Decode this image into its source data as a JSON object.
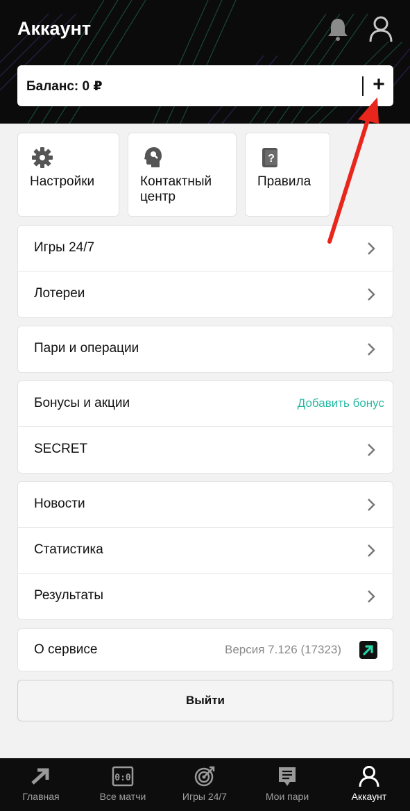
{
  "header": {
    "title": "Аккаунт"
  },
  "balance": {
    "label": "Баланс: 0 ₽",
    "add_symbol": "+"
  },
  "tiles": [
    {
      "label_line1": "Настройки",
      "label_line2": ""
    },
    {
      "label_line1": "Контактный",
      "label_line2": "центр"
    },
    {
      "label_line1": "Правила",
      "label_line2": ""
    }
  ],
  "menu": {
    "games": "Игры 24/7",
    "lotteries": "Лотереи",
    "bets_operations": "Пари и операции",
    "bonuses": "Бонусы и акции",
    "add_bonus": "Добавить бонус",
    "secret": "SECRET",
    "news": "Новости",
    "statistics": "Статистика",
    "results": "Результаты",
    "about": "О сервисе",
    "version": "Версия 7.126 (17323)"
  },
  "logout_label": "Выйти",
  "tabbar": [
    {
      "label": "Главная"
    },
    {
      "label": "Все матчи",
      "icon_text": "0:0"
    },
    {
      "label": "Игры 24/7"
    },
    {
      "label": "Мои пари"
    },
    {
      "label": "Аккаунт"
    }
  ],
  "colors": {
    "accent": "#27b8a3",
    "annotation_arrow": "#e8261c",
    "header_bg": "#0b0b0b"
  }
}
